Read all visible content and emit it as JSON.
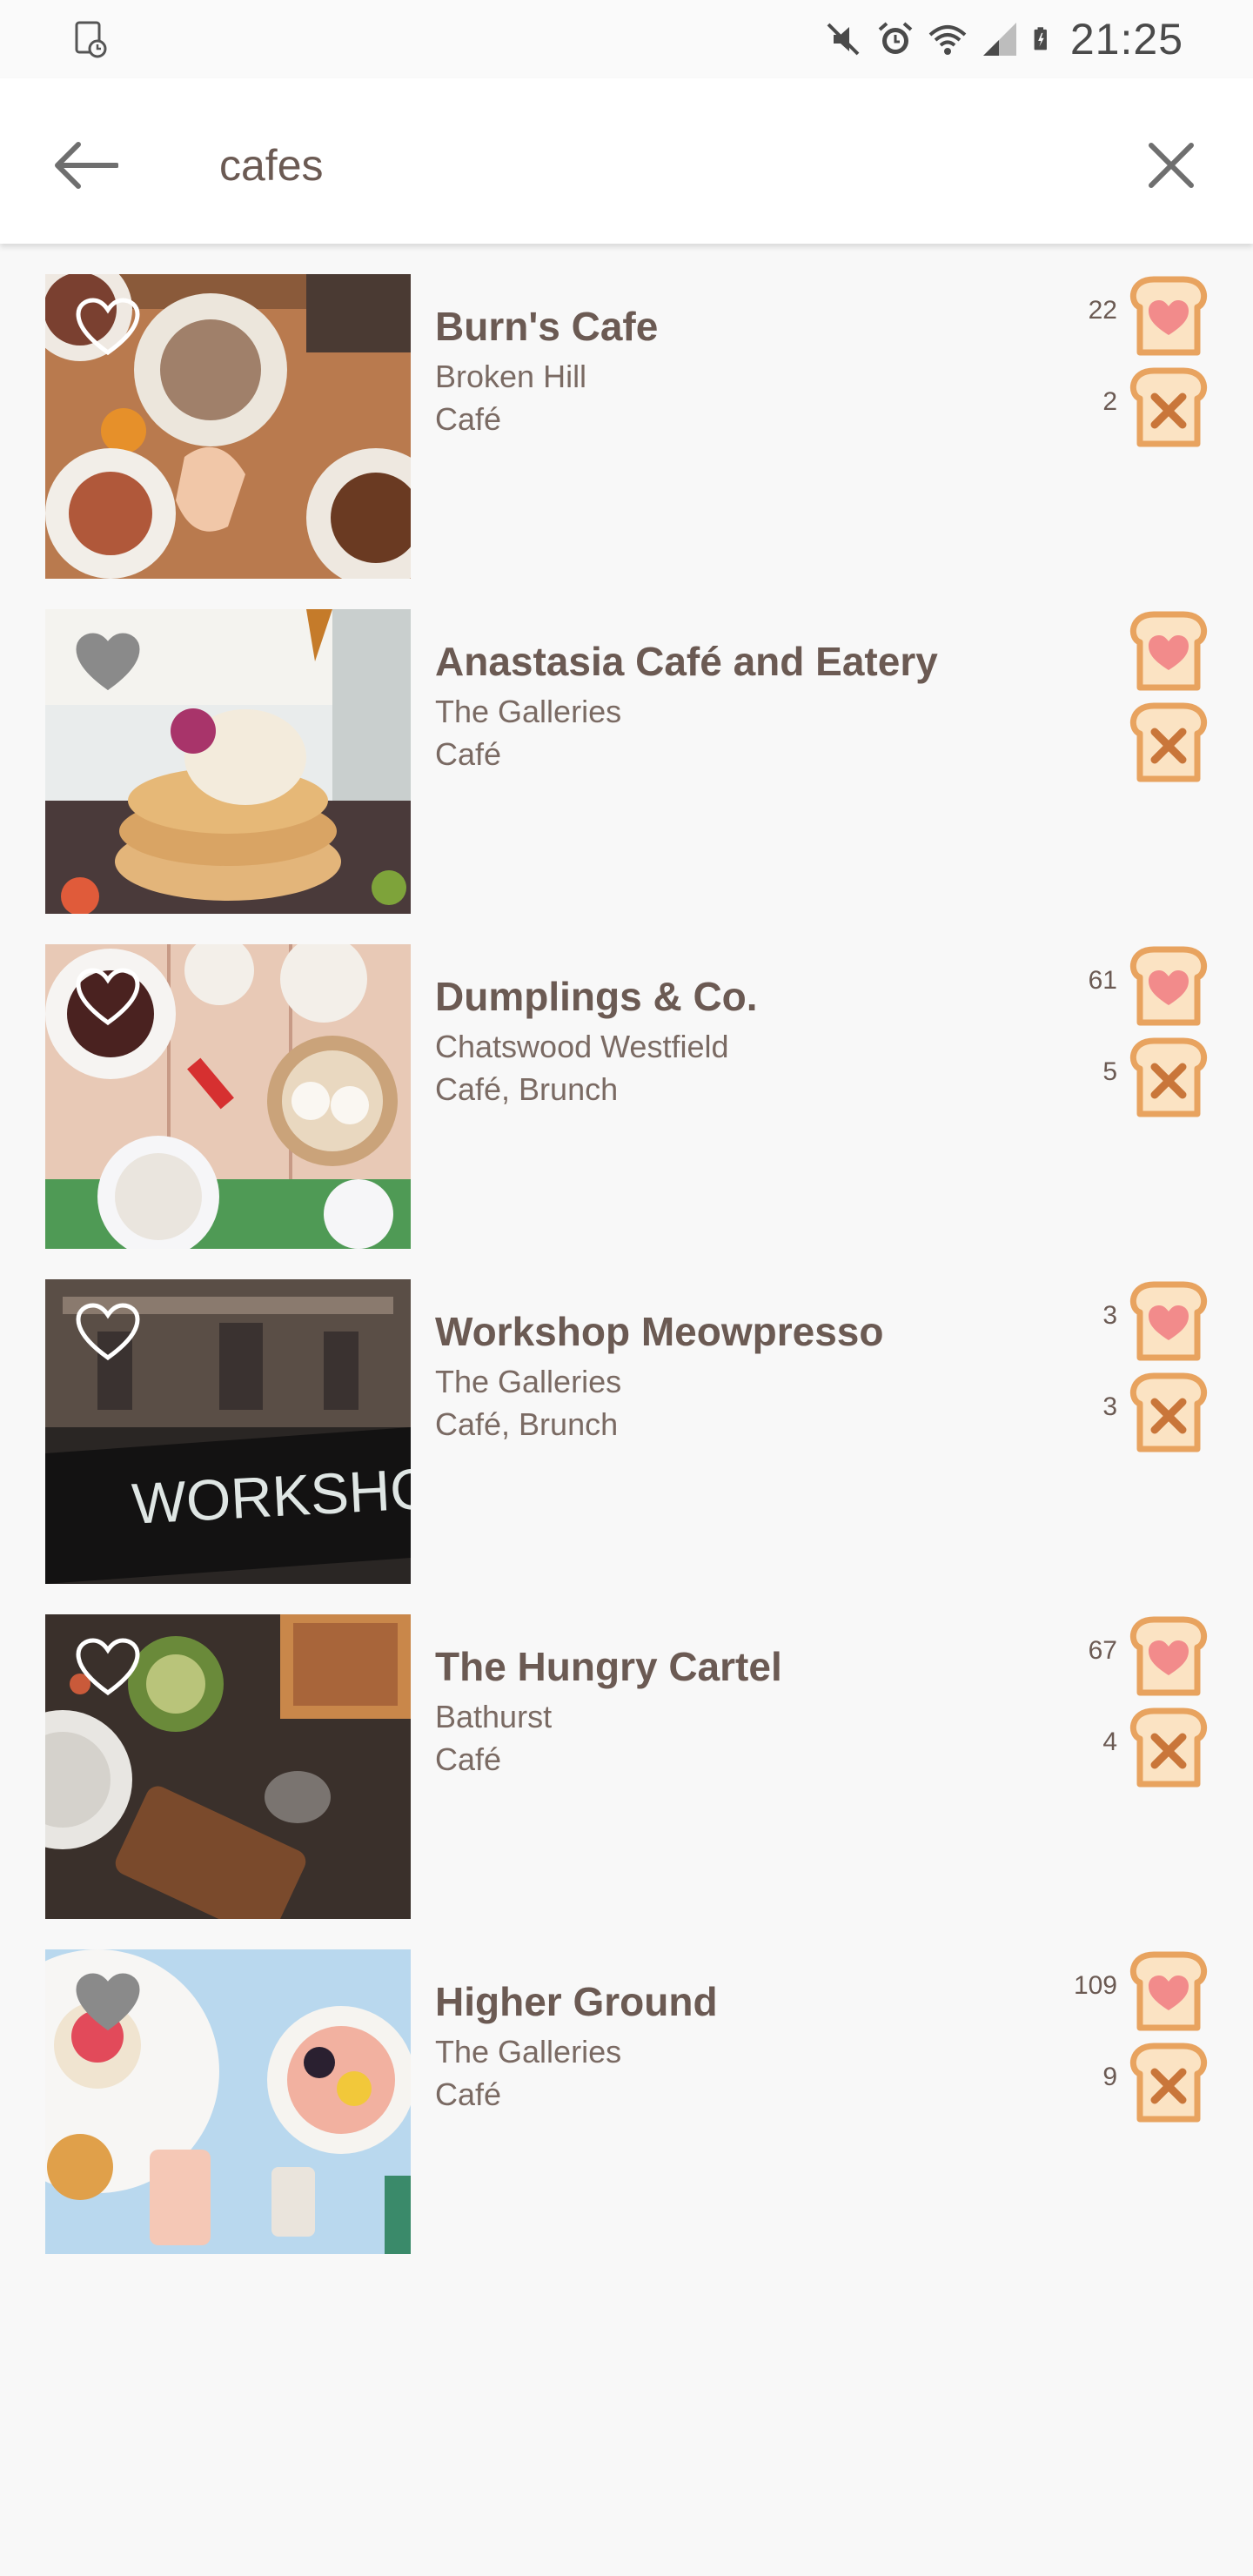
{
  "status_bar": {
    "time": "21:25",
    "icons": [
      "screen-record-icon",
      "mute-icon",
      "alarm-icon",
      "wifi-icon",
      "signal-icon",
      "battery-icon"
    ]
  },
  "search": {
    "query": "cafes",
    "back_icon": "arrow-left-icon",
    "clear_icon": "close-icon"
  },
  "colors": {
    "text_dark": "#6b5a53",
    "toast_crust": "#e8a35f",
    "toast_bread": "#fbe3c3",
    "heart_pink": "#f28b8b",
    "x_brown": "#c9763a"
  },
  "results": [
    {
      "name": "Burn's Cafe",
      "location": "Broken Hill",
      "category": "Café",
      "likes": "22",
      "dislikes": "2",
      "favorited": false
    },
    {
      "name": "Anastasia Café and Eatery",
      "location": "The Galleries",
      "category": "Café",
      "likes": "",
      "dislikes": "",
      "favorited": true
    },
    {
      "name": "Dumplings & Co.",
      "location": "Chatswood Westfield",
      "category": "Café, Brunch",
      "likes": "61",
      "dislikes": "5",
      "favorited": false
    },
    {
      "name": "Workshop Meowpresso",
      "location": "The Galleries",
      "category": "Café, Brunch",
      "likes": "3",
      "dislikes": "3",
      "favorited": false
    },
    {
      "name": "The Hungry Cartel",
      "location": "Bathurst",
      "category": "Café",
      "likes": "67",
      "dislikes": "4",
      "favorited": false
    },
    {
      "name": "Higher Ground",
      "location": "The Galleries",
      "category": "Café",
      "likes": "109",
      "dislikes": "9",
      "favorited": true
    }
  ]
}
